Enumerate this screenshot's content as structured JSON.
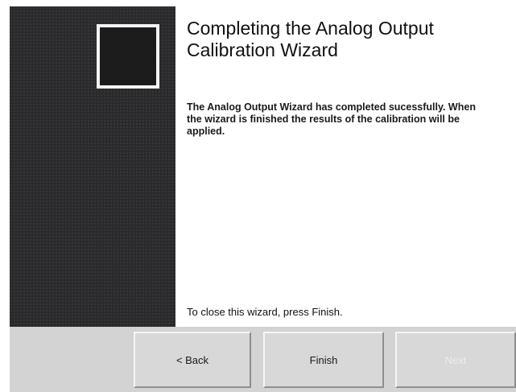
{
  "wizard": {
    "title": "Completing the Analog Output Calibration Wizard",
    "message": "The Analog Output Wizard has completed sucessfully. When the wizard is finished the results of the calibration will be applied.",
    "footer": "To close this wizard, press Finish."
  },
  "buttons": {
    "back_label": "< Back",
    "finish_label": "Finish",
    "next_label": "Next",
    "next_enabled": false
  }
}
